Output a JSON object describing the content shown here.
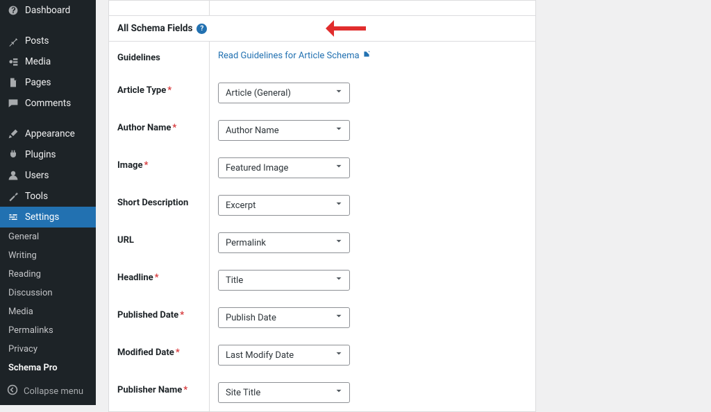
{
  "sidebar": {
    "items": [
      {
        "label": "Dashboard"
      },
      {
        "label": "Posts"
      },
      {
        "label": "Media"
      },
      {
        "label": "Pages"
      },
      {
        "label": "Comments"
      },
      {
        "label": "Appearance"
      },
      {
        "label": "Plugins"
      },
      {
        "label": "Users"
      },
      {
        "label": "Tools"
      },
      {
        "label": "Settings"
      }
    ],
    "subItems": [
      {
        "label": "General"
      },
      {
        "label": "Writing"
      },
      {
        "label": "Reading"
      },
      {
        "label": "Discussion"
      },
      {
        "label": "Media"
      },
      {
        "label": "Permalinks"
      },
      {
        "label": "Privacy"
      },
      {
        "label": "Schema Pro"
      }
    ],
    "collapse": "Collapse menu"
  },
  "panel": {
    "header": "All Schema Fields",
    "fields": {
      "guidelines": {
        "label": "Guidelines",
        "link": "Read Guidelines for Article Schema"
      },
      "articleType": {
        "label": "Article Type",
        "value": "Article (General)"
      },
      "authorName": {
        "label": "Author Name",
        "value": "Author Name"
      },
      "image": {
        "label": "Image",
        "value": "Featured Image"
      },
      "shortDesc": {
        "label": "Short Description",
        "value": "Excerpt"
      },
      "url": {
        "label": "URL",
        "value": "Permalink"
      },
      "headline": {
        "label": "Headline",
        "value": "Title"
      },
      "pubDate": {
        "label": "Published Date",
        "value": "Publish Date"
      },
      "modDate": {
        "label": "Modified Date",
        "value": "Last Modify Date"
      },
      "publisherName": {
        "label": "Publisher Name",
        "value": "Site Title"
      }
    }
  }
}
